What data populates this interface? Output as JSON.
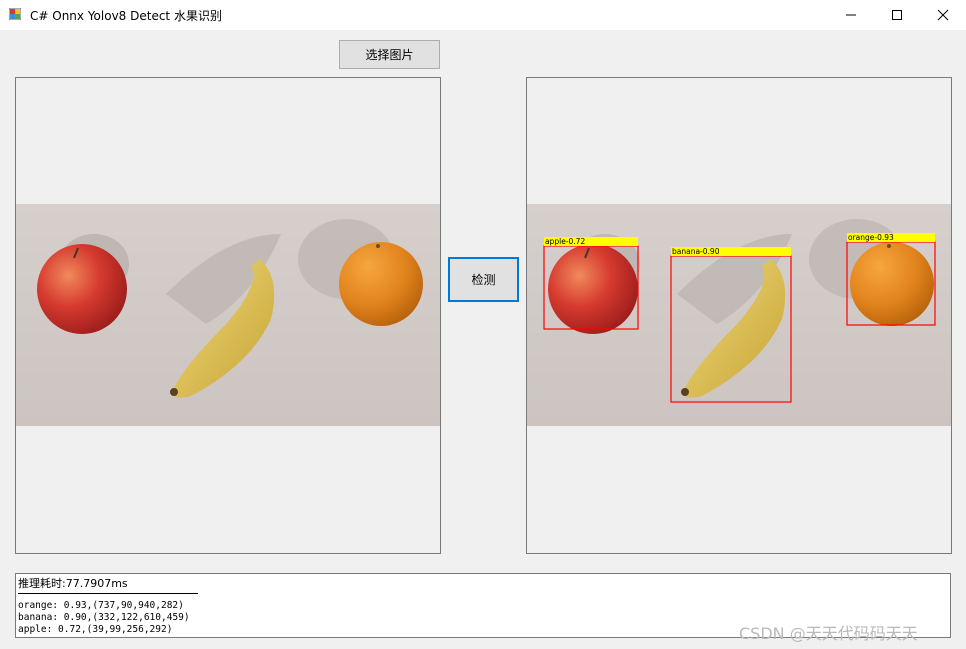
{
  "window": {
    "title": "C# Onnx Yolov8 Detect 水果识别",
    "controls": [
      "minimize-icon",
      "maximize-icon",
      "close-icon"
    ]
  },
  "buttons": {
    "select_image": "选择图片",
    "detect": "检测"
  },
  "detections": [
    {
      "label": "apple-0.72"
    },
    {
      "label": "banana-0.90"
    },
    {
      "label": "orange-0.93"
    }
  ],
  "log": {
    "timing": "推理耗时:77.7907ms",
    "lines": [
      "orange: 0.93,(737,90,940,282)",
      "banana: 0.90,(332,122,610,459)",
      "apple: 0.72,(39,99,256,292)"
    ]
  },
  "watermark": "CSDN @天天代码码天天",
  "colors": {
    "box_stroke": "#ff0000",
    "label_bg": "#ffff00",
    "focus_border": "#0078d7"
  }
}
